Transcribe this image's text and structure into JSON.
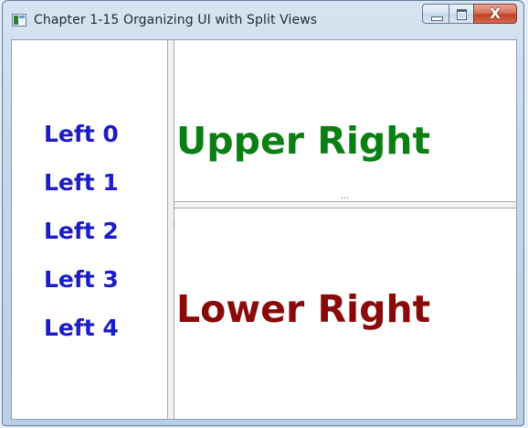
{
  "window": {
    "title": "Chapter 1-15 Organizing UI with Split Views",
    "close_glyph": "X"
  },
  "left_pane": {
    "items": [
      "Left 0",
      "Left 1",
      "Left 2",
      "Left 3",
      "Left 4"
    ],
    "color": "#1c1cc8"
  },
  "upper_right": {
    "label": "Upper Right",
    "color": "#0a7f12"
  },
  "lower_right": {
    "label": "Lower Right",
    "color": "#8a0a0a"
  },
  "splitters": {
    "vertical_grip": "⋮",
    "horizontal_grip": "···"
  }
}
